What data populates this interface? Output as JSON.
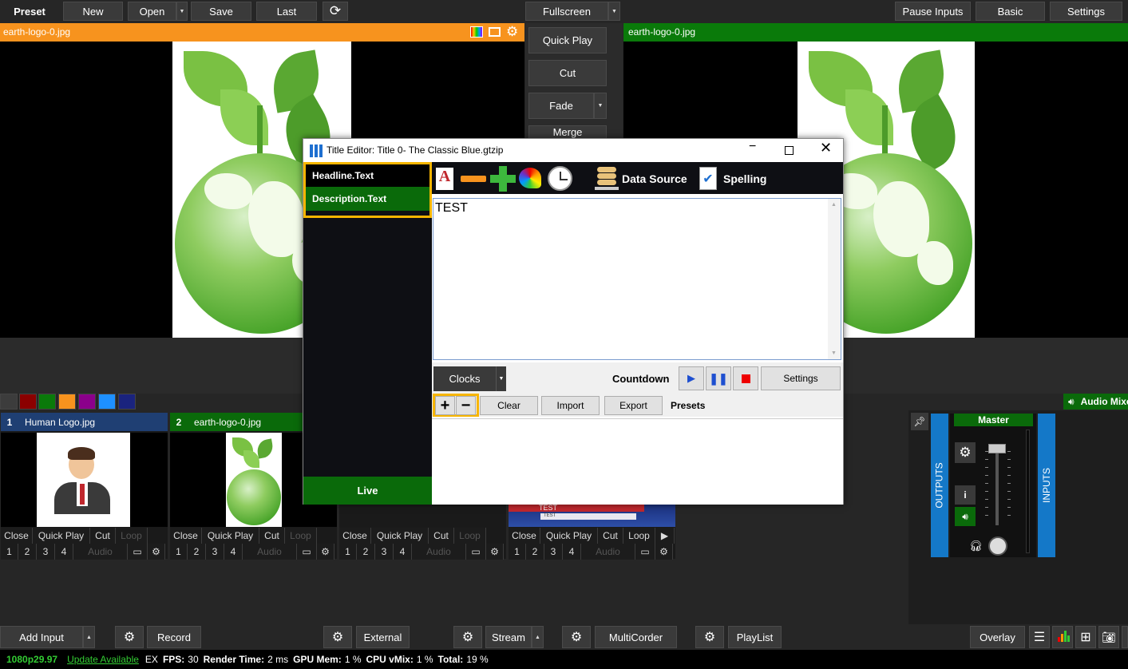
{
  "topbar": {
    "preset": "Preset",
    "new": "New",
    "open": "Open",
    "save": "Save",
    "last": "Last",
    "fullscreen": "Fullscreen",
    "pause_inputs": "Pause Inputs",
    "basic": "Basic",
    "settings": "Settings"
  },
  "preview": {
    "title": "earth-logo-0.jpg",
    "accent": "#f7931e"
  },
  "output": {
    "title": "earth-logo-0.jpg",
    "accent": "#0a7a0a"
  },
  "transitions": {
    "quick_play": "Quick Play",
    "cut": "Cut",
    "fade": "Fade",
    "merge": "Merge"
  },
  "swatches": [
    "#3c3c3c",
    "#8b0000",
    "#0a7a0a",
    "#f7931e",
    "#8b008b",
    "#1e90ff",
    "#1a237e"
  ],
  "inputs": [
    {
      "num": "1",
      "title": "Human Logo.jpg",
      "color": "#1f3f73",
      "buttons": [
        "Close",
        "Quick Play",
        "Cut",
        "Loop"
      ],
      "numbers": [
        "1",
        "2",
        "3",
        "4"
      ],
      "audio": "Audio"
    },
    {
      "num": "2",
      "title": "earth-logo-0.jpg",
      "color": "#0a6a0a",
      "buttons": [
        "Close",
        "Quick Play",
        "Cut",
        "Loop"
      ],
      "numbers": [
        "1",
        "2",
        "3",
        "4"
      ],
      "audio": "Audio"
    },
    {
      "num": "",
      "title": "",
      "color": "#1a1a1a",
      "buttons": [
        "Close",
        "Quick Play",
        "Cut",
        "Loop"
      ],
      "numbers": [
        "1",
        "2",
        "3",
        "4"
      ],
      "audio": "Audio"
    },
    {
      "num": "",
      "title": "",
      "color": "#1a1a1a",
      "buttons": [
        "Close",
        "Quick Play",
        "Cut",
        "Loop"
      ],
      "numbers": [
        "1",
        "2",
        "3",
        "4"
      ],
      "audio": "Audio",
      "thumb_text": "TEST",
      "thumb_sub": "TEST"
    }
  ],
  "title_editor": {
    "title": "Title Editor: Title 0- The Classic Blue.gtzip",
    "fields": [
      "Headline.Text",
      "Description.Text"
    ],
    "live": "Live",
    "data_source": "Data Source",
    "spelling": "Spelling",
    "text_value": "TEST",
    "clocks": "Clocks",
    "countdown": "Countdown",
    "settings": "Settings",
    "clear": "Clear",
    "import": "Import",
    "export": "Export",
    "presets": "Presets"
  },
  "audio": {
    "label": "Audio Mixer",
    "master": "Master",
    "outputs": "OUTPUTS",
    "inputs": "INPUTS",
    "info": "i"
  },
  "bottombar": {
    "add_input": "Add Input",
    "record": "Record",
    "external": "External",
    "stream": "Stream",
    "multicorder": "MultiCorder",
    "playlist": "PlayList",
    "overlay": "Overlay"
  },
  "status": {
    "format": "1080p29.97",
    "update": "Update Available",
    "ex": "EX",
    "fps_label": "FPS:",
    "fps": "30",
    "render_label": "Render Time:",
    "render": "2 ms",
    "gpu_label": "GPU Mem:",
    "gpu": "1 %",
    "cpu_label": "CPU vMix:",
    "cpu": "1 %",
    "total_label": "Total:",
    "total": "19 %"
  }
}
